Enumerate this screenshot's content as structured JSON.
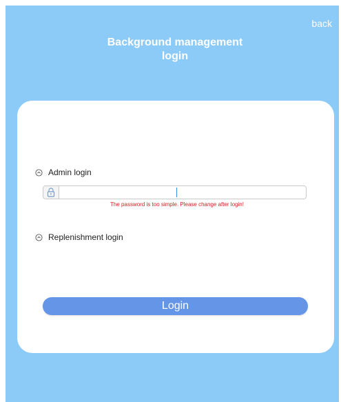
{
  "header": {
    "back_label": "back",
    "title_line1": "Background management",
    "title_line2": "login"
  },
  "form": {
    "admin_label": "Admin login",
    "replenishment_label": "Replenishment login",
    "password_value": "",
    "password_placeholder": "",
    "error_message": "The password is too simple. Please change after login!",
    "login_label": "Login"
  },
  "colors": {
    "background": "#8ccaf8",
    "button": "#6495e6",
    "error": "#d42020"
  },
  "icons": {
    "lock": "lock-icon",
    "radio": "radio-icon"
  }
}
